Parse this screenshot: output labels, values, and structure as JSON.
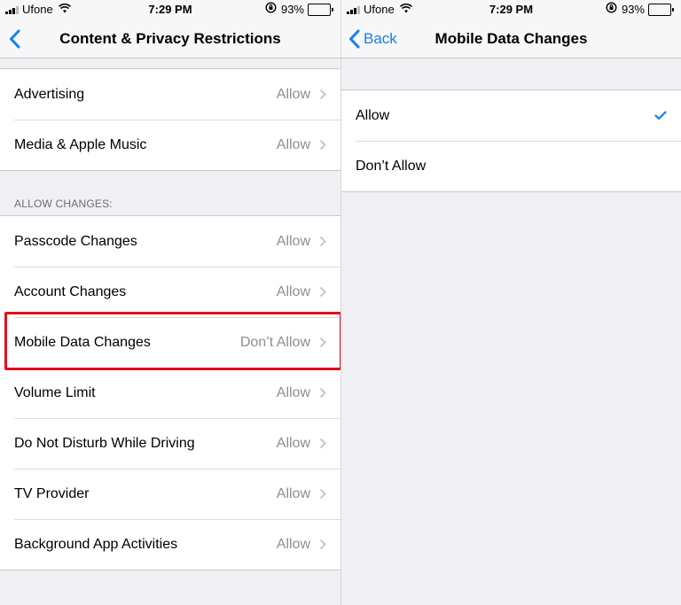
{
  "status_bar": {
    "carrier": "Ufone",
    "time": "7:29 PM",
    "battery": "93%",
    "battery_level": 0.93,
    "icons": [
      "signal-icon",
      "wifi-icon",
      "orientation-lock-icon",
      "battery-icon"
    ]
  },
  "left": {
    "nav_title": "Content & Privacy Restrictions",
    "back_icon": "chevron-left-icon",
    "top_rows": [
      {
        "label": "Advertising",
        "value": "Allow"
      },
      {
        "label": "Media & Apple Music",
        "value": "Allow"
      }
    ],
    "section_header": "ALLOW CHANGES:",
    "changes_rows": [
      {
        "label": "Passcode Changes",
        "value": "Allow"
      },
      {
        "label": "Account Changes",
        "value": "Allow"
      },
      {
        "label": "Mobile Data Changes",
        "value": "Don’t Allow",
        "highlighted": true
      },
      {
        "label": "Volume Limit",
        "value": "Allow"
      },
      {
        "label": "Do Not Disturb While Driving",
        "value": "Allow"
      },
      {
        "label": "TV Provider",
        "value": "Allow"
      },
      {
        "label": "Background App Activities",
        "value": "Allow"
      }
    ]
  },
  "right": {
    "back_label": "Back",
    "nav_title": "Mobile Data Changes",
    "options": [
      {
        "label": "Allow",
        "selected": true
      },
      {
        "label": "Don’t Allow",
        "selected": false
      }
    ]
  },
  "colors": {
    "accent": "#147efb",
    "highlight": "#e3101a",
    "background": "#efeff4",
    "secondary_text": "#8e8e93"
  }
}
